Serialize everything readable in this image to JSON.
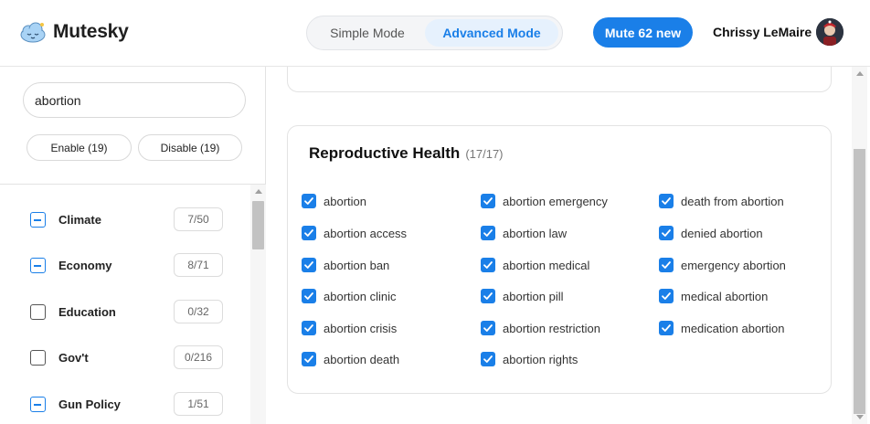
{
  "app": {
    "name": "Mutesky",
    "logo_icon": "cloud-icon"
  },
  "header": {
    "modes": [
      {
        "label": "Simple Mode",
        "active": false
      },
      {
        "label": "Advanced Mode",
        "active": true
      }
    ],
    "mute_button": "Mute 62 new",
    "user_name": "Chrissy LeMaire"
  },
  "sidebar": {
    "search_value": "abortion",
    "enable_label": "Enable (19)",
    "disable_label": "Disable (19)",
    "categories": [
      {
        "name": "Climate",
        "count": "7/50",
        "state": "partial"
      },
      {
        "name": "Economy",
        "count": "8/71",
        "state": "partial"
      },
      {
        "name": "Education",
        "count": "0/32",
        "state": "unchecked"
      },
      {
        "name": "Gov't",
        "count": "0/216",
        "state": "unchecked"
      },
      {
        "name": "Gun Policy",
        "count": "1/51",
        "state": "partial"
      }
    ]
  },
  "main": {
    "section_title": "Reproductive Health",
    "section_count": "(17/17)",
    "keywords": [
      "abortion",
      "abortion access",
      "abortion ban",
      "abortion clinic",
      "abortion crisis",
      "abortion death",
      "abortion emergency",
      "abortion law",
      "abortion medical",
      "abortion pill",
      "abortion restriction",
      "abortion rights",
      "death from abortion",
      "denied abortion",
      "emergency abortion",
      "medical abortion",
      "medication abortion"
    ]
  },
  "colors": {
    "accent": "#1a7fe8",
    "accent_light": "#e6f1fd"
  }
}
